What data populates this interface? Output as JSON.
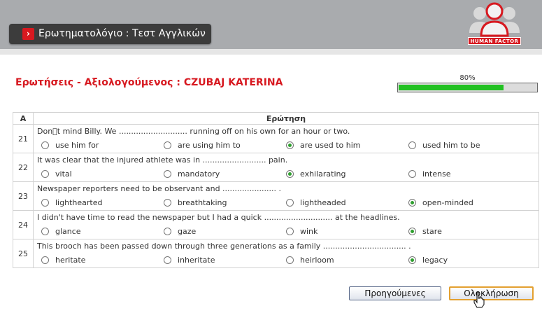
{
  "header": {
    "title": "Ερωτηματολόγιο : Τεστ Αγγλικών",
    "logo_text": "HUMAN FACTOR"
  },
  "heading": "Ερωτήσεις - Αξιολογούμενος : CZUBAJ KATERINA",
  "progress": {
    "label": "80%",
    "value": 0.8
  },
  "table": {
    "col_num": "Α",
    "col_question": "Ερώτηση",
    "rows": [
      {
        "num": "21",
        "text": "Don\u0000t mind Billy. We ............................ running off on his own for an hour or two.",
        "options": [
          "use him for",
          "are using him to",
          "are used to him",
          "used him to be"
        ],
        "selected": 2
      },
      {
        "num": "22",
        "text": "It was clear that the injured athlete was in .......................... pain.",
        "options": [
          "vital",
          "mandatory",
          "exhilarating",
          "intense"
        ],
        "selected": 2
      },
      {
        "num": "23",
        "text": "Newspaper reporters need to be observant and ...................... .",
        "options": [
          "lighthearted",
          "breathtaking",
          "lightheaded",
          "open-minded"
        ],
        "selected": 3
      },
      {
        "num": "24",
        "text": "I didn't have time to read the newspaper but I had a quick ............................ at the headlines.",
        "options": [
          "glance",
          "gaze",
          "wink",
          "stare"
        ],
        "selected": 3
      },
      {
        "num": "25",
        "text": "This brooch has been passed down through three generations as a family .................................. .",
        "options": [
          "heritate",
          "inheritate",
          "heirloom",
          "legacy"
        ],
        "selected": 3
      }
    ]
  },
  "buttons": {
    "previous": "Προηγούμενες",
    "finish": "Ολοκλήρωση"
  },
  "colors": {
    "accent": "#d71920",
    "progress": "#22c122",
    "header_bg": "#a9abae"
  }
}
